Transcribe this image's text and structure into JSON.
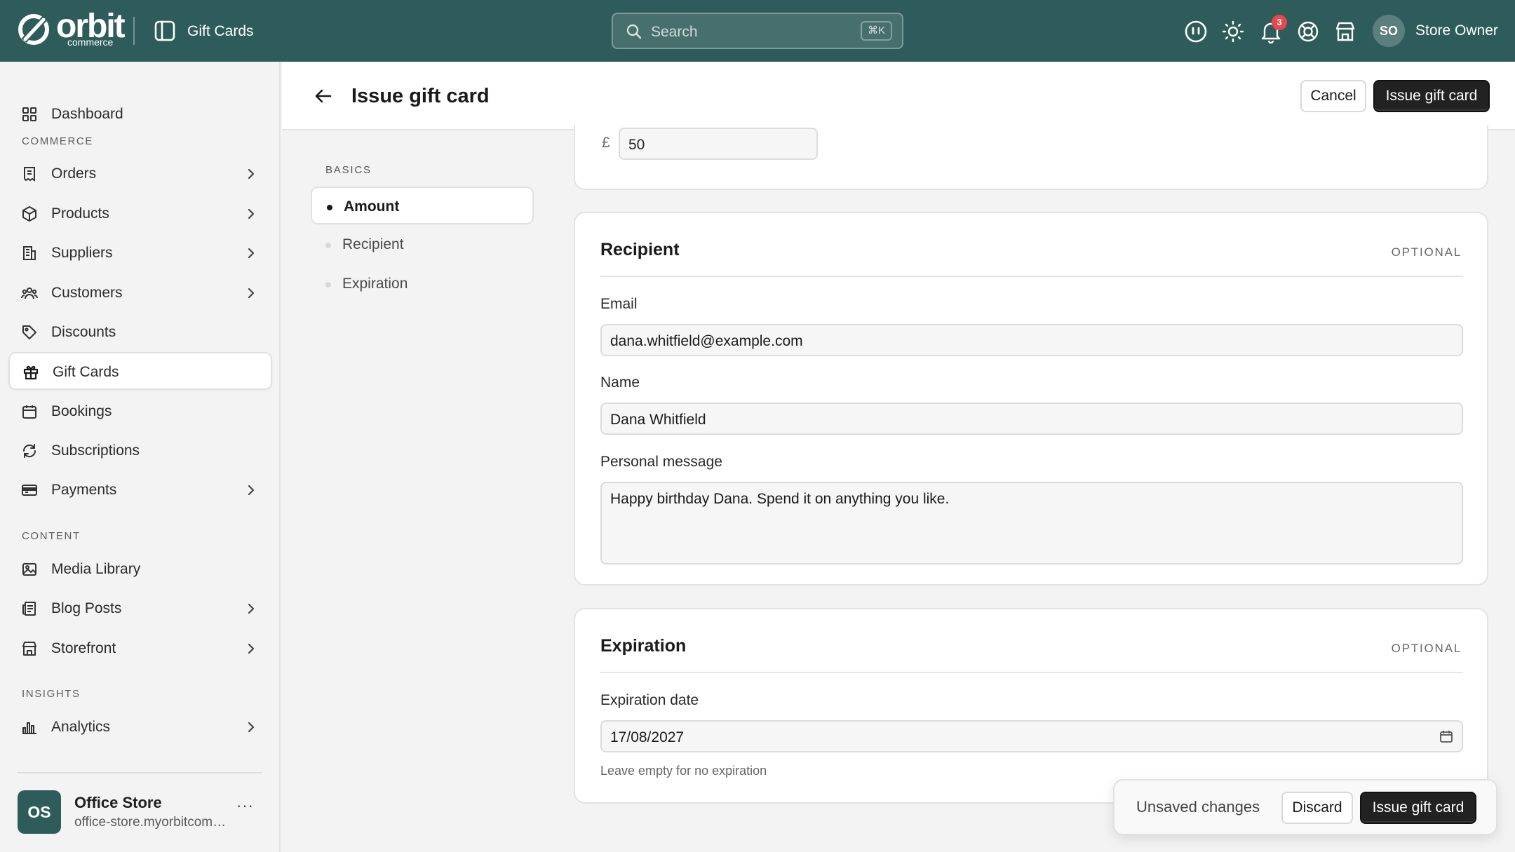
{
  "header": {
    "logo_text": "orbit",
    "logo_sub": "commerce",
    "section_title": "Gift Cards",
    "search": {
      "placeholder": "Search",
      "shortcut": "⌘K"
    },
    "notification_count": "3",
    "user": {
      "initials": "SO",
      "name": "Store Owner"
    }
  },
  "sidebar": {
    "dashboard": "Dashboard",
    "sections": {
      "commerce": "COMMERCE",
      "content": "CONTENT",
      "insights": "INSIGHTS"
    },
    "items": {
      "orders": "Orders",
      "products": "Products",
      "suppliers": "Suppliers",
      "customers": "Customers",
      "discounts": "Discounts",
      "gift_cards": "Gift Cards",
      "bookings": "Bookings",
      "subscriptions": "Subscriptions",
      "payments": "Payments",
      "media_library": "Media Library",
      "blog_posts": "Blog Posts",
      "storefront": "Storefront",
      "analytics": "Analytics"
    },
    "store": {
      "initials": "OS",
      "name": "Office Store",
      "url": "office-store.myorbitcommerce.com"
    }
  },
  "page": {
    "title": "Issue gift card",
    "cancel_label": "Cancel",
    "submit_label": "Issue gift card"
  },
  "subnav": {
    "group": "BASICS",
    "items": [
      "Amount",
      "Recipient",
      "Expiration"
    ]
  },
  "amount": {
    "currency": "£",
    "value": "50"
  },
  "recipient": {
    "title": "Recipient",
    "tag": "OPTIONAL",
    "email_label": "Email",
    "email_value": "dana.whitfield@example.com",
    "name_label": "Name",
    "name_value": "Dana Whitfield",
    "message_label": "Personal message",
    "message_value": "Happy birthday Dana. Spend it on anything you like."
  },
  "expiration": {
    "title": "Expiration",
    "tag": "OPTIONAL",
    "date_label": "Expiration date",
    "date_value": "17/08/2027",
    "help": "Leave empty for no expiration"
  },
  "unsaved_bar": {
    "text": "Unsaved changes",
    "discard_label": "Discard",
    "submit_label": "Issue gift card"
  }
}
